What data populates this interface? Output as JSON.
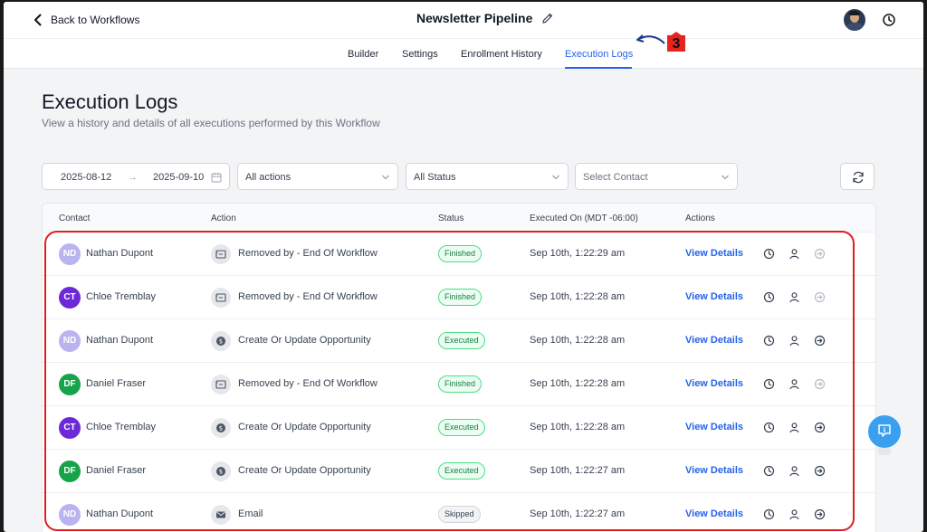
{
  "header": {
    "back_label": "Back to Workflows",
    "workflow_title": "Newsletter Pipeline"
  },
  "tabs": [
    {
      "label": "Builder"
    },
    {
      "label": "Settings"
    },
    {
      "label": "Enrollment History"
    },
    {
      "label": "Execution Logs",
      "active": true
    }
  ],
  "annotation": {
    "number": "3",
    "color": "#e8231d"
  },
  "page": {
    "title": "Execution Logs",
    "subtitle": "View a history and details of all executions performed by this Workflow"
  },
  "filters": {
    "date_from": "2025-08-12",
    "date_arrow": "→",
    "date_to": "2025-09-10",
    "action_select": "All actions",
    "status_select": "All Status",
    "contact_placeholder": "Select Contact"
  },
  "table": {
    "columns": [
      "Contact",
      "Action",
      "Status",
      "Executed On (MDT -06:00)",
      "Actions"
    ],
    "view_details_label": "View Details",
    "rows": [
      {
        "initials": "ND",
        "contact": "Nathan Dupont",
        "avatar_color": "#b9b4f0",
        "action_icon": "remove-workflow-icon",
        "action": "Removed by - End Of Workflow",
        "status": "Finished",
        "status_kind": "finished",
        "executed_on": "Sep 10th, 1:22:29 am",
        "exit_icon_muted": true
      },
      {
        "initials": "CT",
        "contact": "Chloe Tremblay",
        "avatar_color": "#6d28d9",
        "action_icon": "remove-workflow-icon",
        "action": "Removed by - End Of Workflow",
        "status": "Finished",
        "status_kind": "finished",
        "executed_on": "Sep 10th, 1:22:28 am",
        "exit_icon_muted": true
      },
      {
        "initials": "ND",
        "contact": "Nathan Dupont",
        "avatar_color": "#b9b4f0",
        "action_icon": "dollar-icon",
        "action": "Create Or Update Opportunity",
        "status": "Executed",
        "status_kind": "executed",
        "executed_on": "Sep 10th, 1:22:28 am",
        "exit_icon_muted": false
      },
      {
        "initials": "DF",
        "contact": "Daniel Fraser",
        "avatar_color": "#16a34a",
        "action_icon": "remove-workflow-icon",
        "action": "Removed by - End Of Workflow",
        "status": "Finished",
        "status_kind": "finished",
        "executed_on": "Sep 10th, 1:22:28 am",
        "exit_icon_muted": true
      },
      {
        "initials": "CT",
        "contact": "Chloe Tremblay",
        "avatar_color": "#6d28d9",
        "action_icon": "dollar-icon",
        "action": "Create Or Update Opportunity",
        "status": "Executed",
        "status_kind": "executed",
        "executed_on": "Sep 10th, 1:22:28 am",
        "exit_icon_muted": false
      },
      {
        "initials": "DF",
        "contact": "Daniel Fraser",
        "avatar_color": "#16a34a",
        "action_icon": "dollar-icon",
        "action": "Create Or Update Opportunity",
        "status": "Executed",
        "status_kind": "executed",
        "executed_on": "Sep 10th, 1:22:27 am",
        "exit_icon_muted": false
      },
      {
        "initials": "ND",
        "contact": "Nathan Dupont",
        "avatar_color": "#b9b4f0",
        "action_icon": "email-icon",
        "action": "Email",
        "status": "Skipped",
        "status_kind": "skipped",
        "executed_on": "Sep 10th, 1:22:27 am",
        "exit_icon_muted": false
      }
    ]
  },
  "colors": {
    "accent": "#2563eb",
    "highlight": "#e11d22",
    "help": "#3b9ff0"
  }
}
